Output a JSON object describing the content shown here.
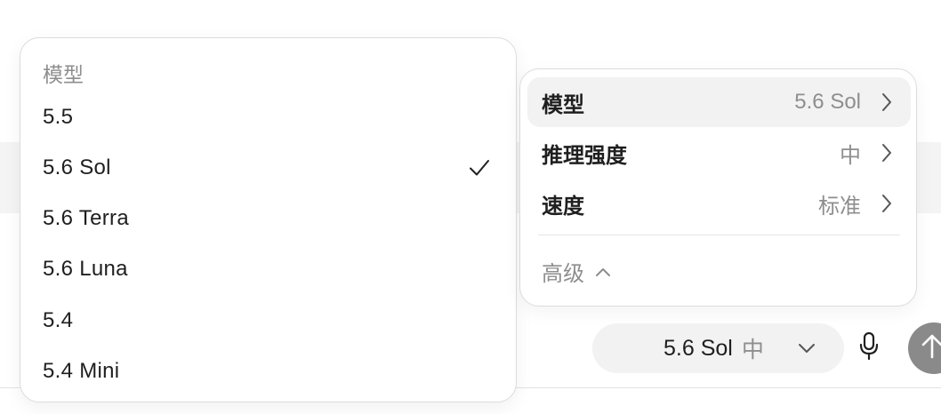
{
  "model_menu": {
    "heading": "模型",
    "items": [
      {
        "label": "5.5",
        "selected": false
      },
      {
        "label": "5.6 Sol",
        "selected": true
      },
      {
        "label": "5.6 Terra",
        "selected": false
      },
      {
        "label": "5.6 Luna",
        "selected": false
      },
      {
        "label": "5.4",
        "selected": false
      },
      {
        "label": "5.4 Mini",
        "selected": false
      }
    ]
  },
  "settings_panel": {
    "rows": [
      {
        "name": "模型",
        "value": "5.6 Sol"
      },
      {
        "name": "推理强度",
        "value": "中"
      },
      {
        "name": "速度",
        "value": "标准"
      }
    ],
    "advanced_label": "高级"
  },
  "composer": {
    "model_label": "5.6 Sol",
    "effort_label": "中"
  },
  "icons": {
    "check": "check-icon",
    "chevron_right": "chevron-right-icon",
    "chevron_up": "chevron-up-icon",
    "chevron_down": "chevron-down-icon",
    "mic": "mic-icon",
    "send": "arrow-up-icon"
  },
  "colors": {
    "muted_text": "#8e8e8e",
    "row_highlight": "#f2f2f2",
    "send_button": "#8a8a8a"
  }
}
